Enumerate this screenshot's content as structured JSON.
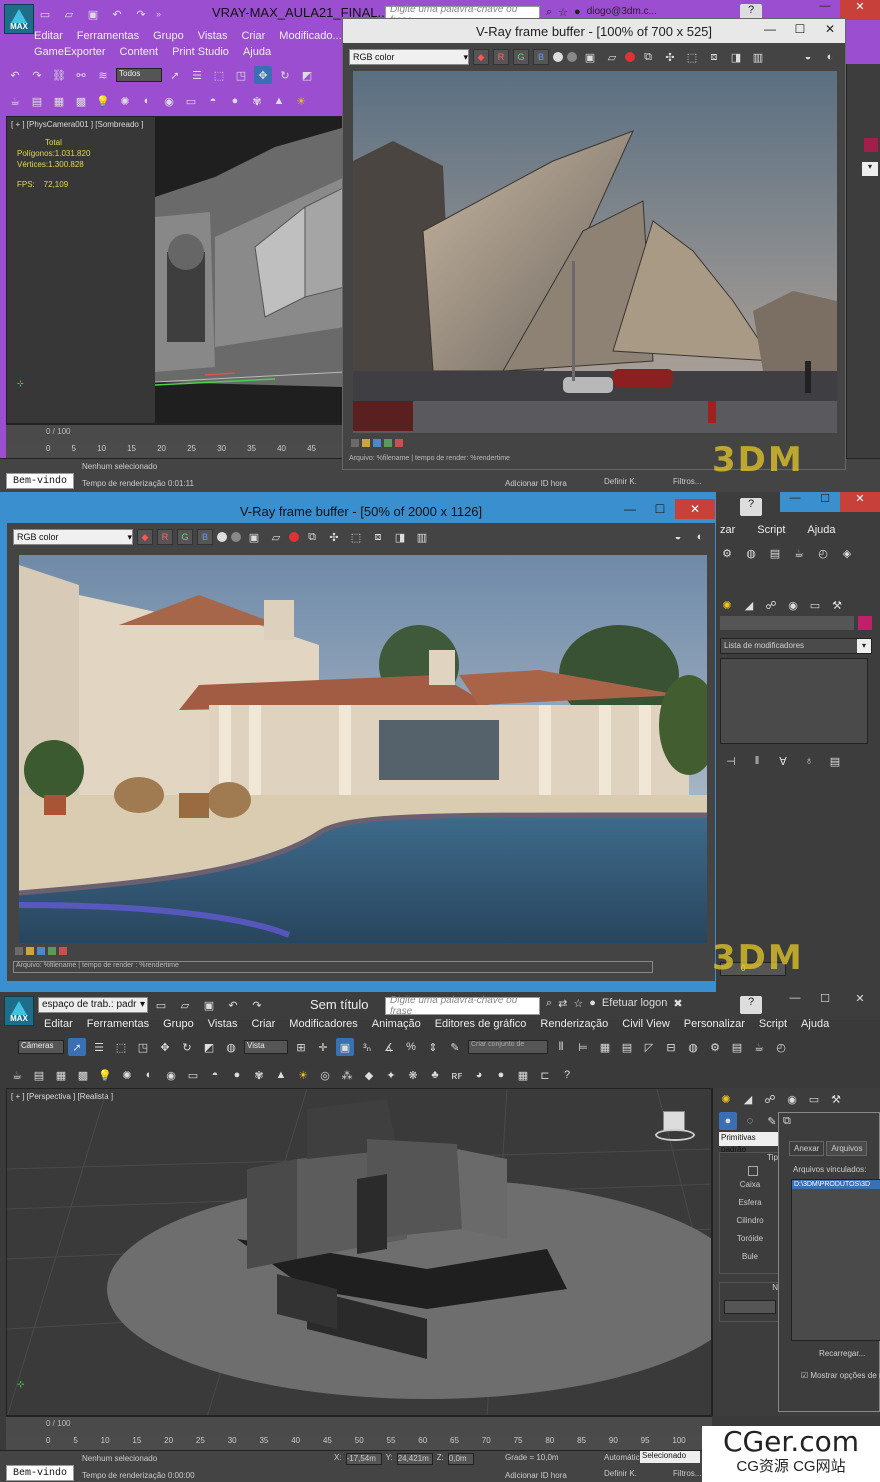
{
  "colors": {
    "section1_frame": "#9b4fd0",
    "section2_frame": "#3a8fcf",
    "close_red": "#c8403a",
    "stats_yellow": "#e0d94a"
  },
  "s1": {
    "window_title": "VRAY-MAX_AULA21_FINAL...",
    "search_placeholder": "Digite uma palavra-chave ou frase",
    "user": "diogo@3dm.c...",
    "help": "?",
    "menu": [
      "Editar",
      "Ferramentas",
      "Grupo",
      "Vistas",
      "Criar",
      "Modificado...",
      "GameExporter",
      "Content",
      "Print Studio",
      "Ajuda"
    ],
    "selection_filter": "Todos",
    "viewport_label": "[ + ] [PhysCamera001 ] [Sombreado ]",
    "stats": {
      "total": "Total",
      "polygons": "Polígonos:1.031.820",
      "vertices": "Vértices:1.300.828",
      "fps_label": "FPS:",
      "fps_value": "72,109"
    },
    "timeline": "0 / 100",
    "ticks": [
      "0",
      "5",
      "10",
      "15",
      "20",
      "25",
      "30",
      "35",
      "40",
      "45"
    ],
    "welcome": "Bem-vindo",
    "status_line1": "Nenhum selecionado",
    "status_line2": "Tempo de renderização  0:01:11",
    "add_time_tag": "Adicionar ID hora",
    "set_key": "Definir K.",
    "filters": "Filtros..."
  },
  "vfb1": {
    "title": "V-Ray frame buffer - [100% of 700 x 525]",
    "channel": "RGB color",
    "footer": "Arquivo: %filename | tempo de render: %rendertime"
  },
  "s2": {
    "menu": [
      "zar",
      "Script",
      "Ajuda"
    ],
    "modifier_list": "Lista de modificadores",
    "help": "?",
    "frame_field": "0"
  },
  "vfb2": {
    "title": "V-Ray frame buffer - [50% of 2000 x 1126]",
    "channel": "RGB color",
    "footer": "Arquivo: %filename | tempo de render : %rendertime"
  },
  "s3": {
    "workspace": "espaço de trab.: padr",
    "doc_title": "Sem título",
    "search_placeholder": "Digite uma palavra-chave ou frase",
    "login": "Efetuar logon",
    "help": "?",
    "menu": [
      "Editar",
      "Ferramentas",
      "Grupo",
      "Vistas",
      "Criar",
      "Modificadores",
      "Animação",
      "Editores de gráfico",
      "Renderização",
      "Civil View",
      "Personalizar",
      "Script",
      "Ajuda"
    ],
    "filter_cameras": "Câmeras",
    "ref_coord": "Vista",
    "selection_set": "Criar conjunto de",
    "viewport_label": "[ + ] [Perspectiva ] [Realista ]",
    "primitives": "Primitivas padrão",
    "object_types_header": "Tip",
    "object_buttons": [
      "Caixa",
      "Esfera",
      "Cilindro",
      "Toróide",
      "Bule"
    ],
    "name_header": "N",
    "timeline": "0 / 100",
    "ticks": [
      "0",
      "5",
      "10",
      "15",
      "20",
      "25",
      "30",
      "35",
      "40",
      "45",
      "50",
      "55",
      "60",
      "65",
      "70",
      "75",
      "80",
      "85",
      "90",
      "95",
      "100"
    ],
    "welcome": "Bem-vindo",
    "status_line1": "Nenhum selecionado",
    "status_line2": "Tempo de renderização  0:00:00",
    "x_value": "-17,54m",
    "y_value": "24,421m",
    "z_value": "0,0m",
    "grid": "Grade = 10,0m",
    "add_time_tag": "Adicionar ID hora",
    "auto": "Automátic",
    "selected": "Selecionado",
    "set_key": "Definir K.",
    "filters": "Filtros..."
  },
  "arquivos": {
    "tab_anexar": "Anexar",
    "tab_arquivos": "Arquivos",
    "linked_label": "Arquivos vinculados:",
    "linked_item": "D:\\3DM\\PRODUTOS\\3D",
    "reload": "Recarregar...",
    "show_options": "Mostrar opções de r"
  },
  "watermarks": {
    "brand": "3DM",
    "cger_big": "CGer.com",
    "cger_small": "CG资源  CG网站"
  }
}
